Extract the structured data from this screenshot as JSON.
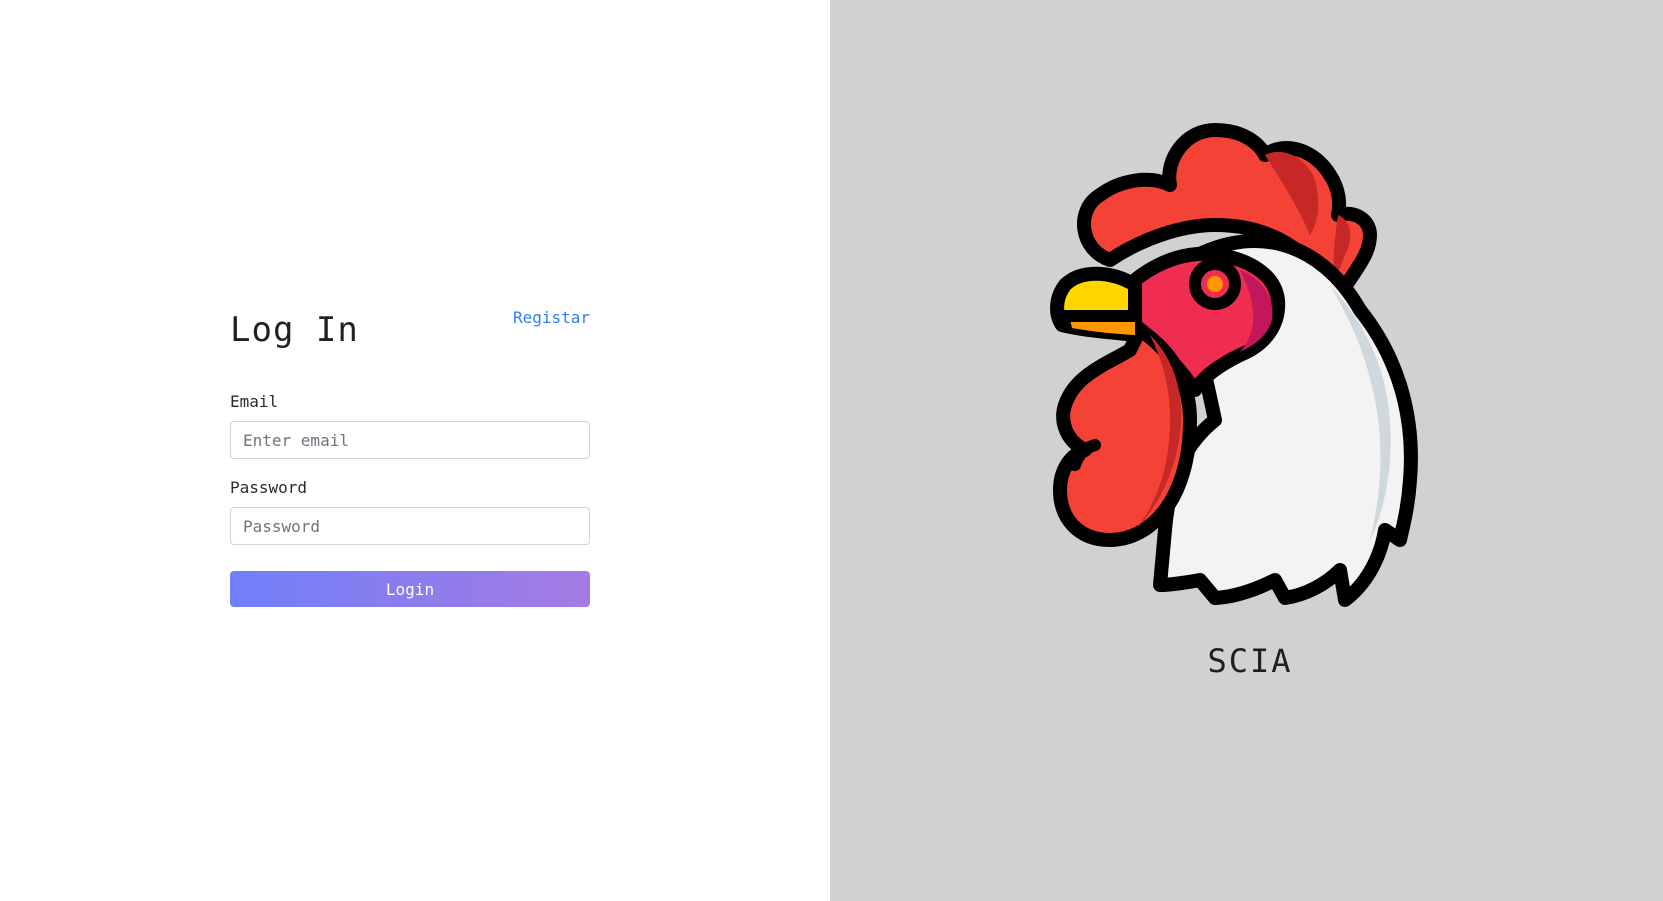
{
  "login": {
    "title": "Log In",
    "register_link": "Registar",
    "email_label": "Email",
    "email_placeholder": "Enter email",
    "password_label": "Password",
    "password_placeholder": "Password",
    "submit_label": "Login"
  },
  "brand": {
    "name": "SCIA",
    "logo_icon": "rooster-head-icon"
  },
  "colors": {
    "right_panel_bg": "#d0d2d1",
    "link": "#2f80ed",
    "button_gradient_start": "#717ff8",
    "button_gradient_end": "#a47be3"
  }
}
